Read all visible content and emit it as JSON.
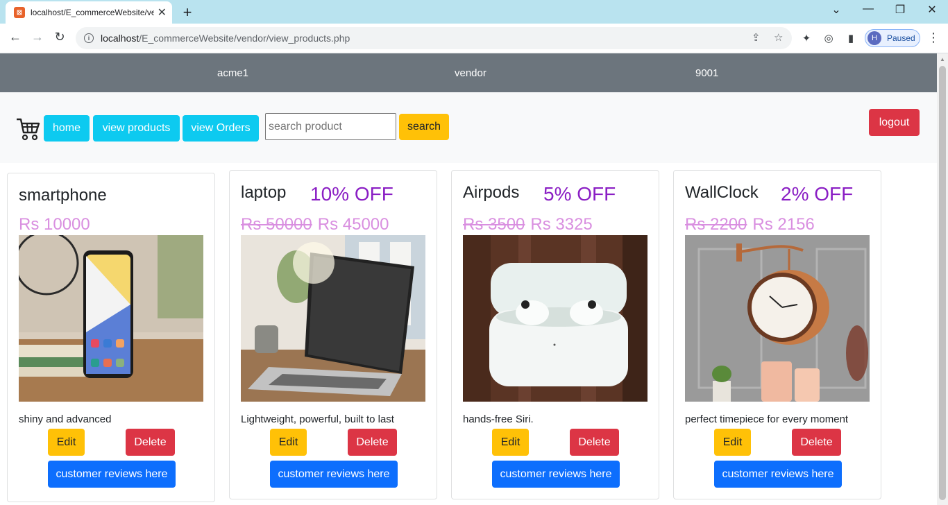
{
  "browser": {
    "tab_title": "localhost/E_commerceWebsite/ve",
    "url_host": "localhost",
    "url_path": "/E_commerceWebsite/vendor/view_products.php",
    "profile_initial": "H",
    "profile_status": "Paused"
  },
  "vendor_bar": {
    "username": "acme1",
    "role": "vendor",
    "code": "9001"
  },
  "nav": {
    "home": "home",
    "view_products": "view products",
    "view_orders": "view Orders",
    "search_placeholder": "search product",
    "search_button": "search",
    "logout": "logout"
  },
  "products": [
    {
      "name": "smartphone",
      "discount": "",
      "old_price": "",
      "price": "Rs 10000",
      "description": "shiny and advanced",
      "image": "smartphone",
      "edit": "Edit",
      "delete": "Delete",
      "reviews": "customer reviews here"
    },
    {
      "name": "laptop",
      "discount": "10% OFF",
      "old_price": "Rs 50000",
      "price": "Rs 45000",
      "description": "Lightweight, powerful, built to last",
      "image": "laptop",
      "edit": "Edit",
      "delete": "Delete",
      "reviews": "customer reviews here"
    },
    {
      "name": "Airpods",
      "discount": "5% OFF",
      "old_price": "Rs 3500",
      "price": "Rs 3325",
      "description": "hands-free Siri.",
      "image": "airpods",
      "edit": "Edit",
      "delete": "Delete",
      "reviews": "customer reviews here"
    },
    {
      "name": "WallClock",
      "discount": "2% OFF",
      "old_price": "Rs 2200",
      "price": "Rs 2156",
      "description": "perfect timepiece for every moment",
      "image": "wall-clock",
      "edit": "Edit",
      "delete": "Delete",
      "reviews": "customer reviews here"
    }
  ]
}
